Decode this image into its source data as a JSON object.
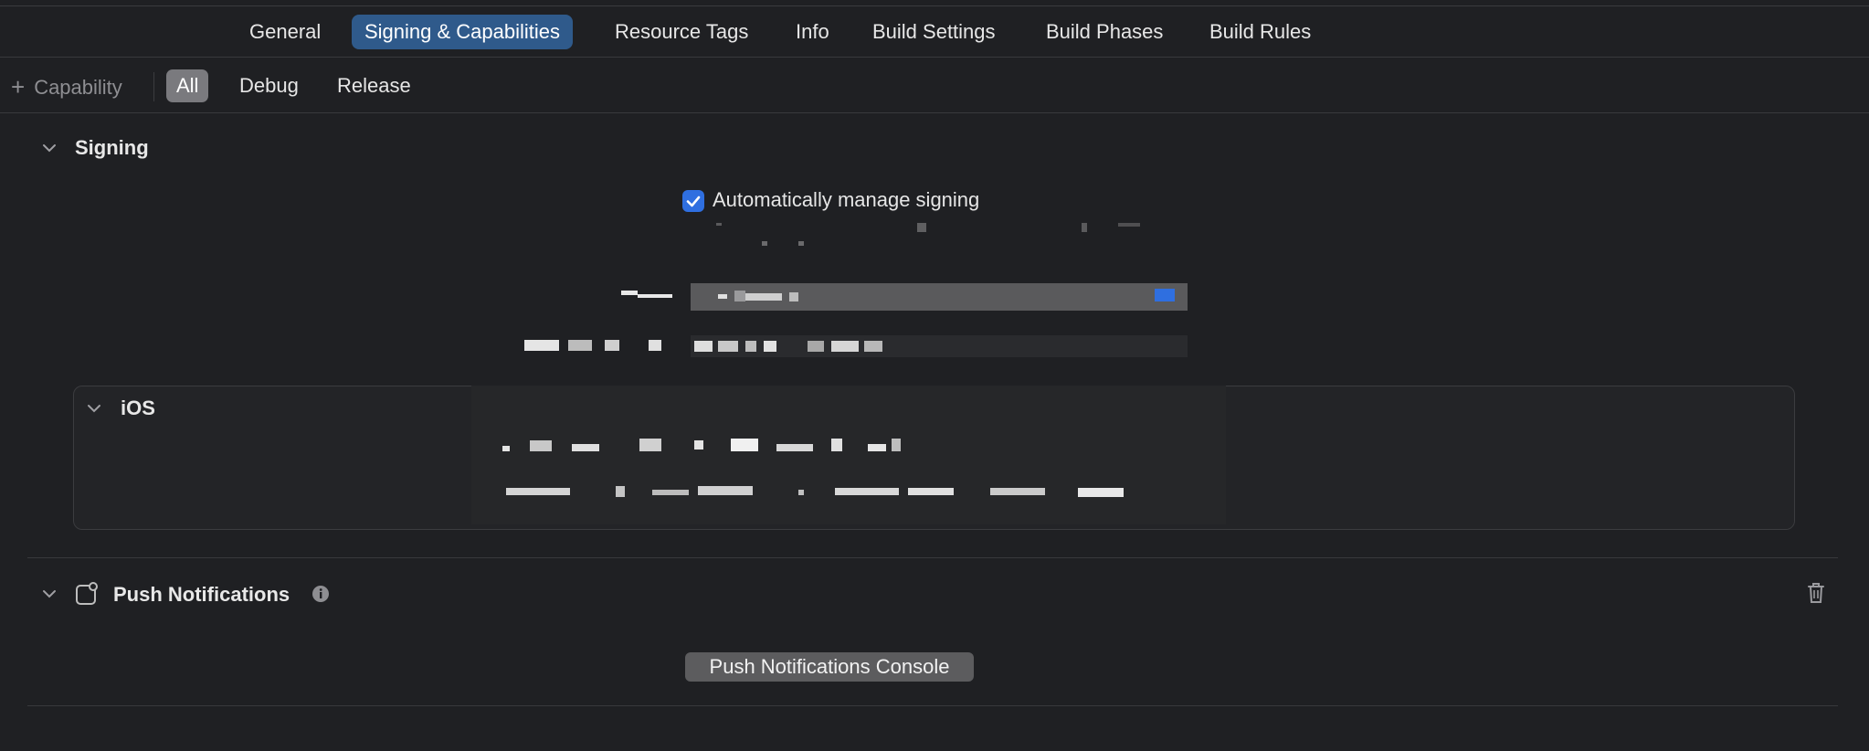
{
  "tabs": [
    {
      "label": "General",
      "active": false
    },
    {
      "label": "Signing & Capabilities",
      "active": true
    },
    {
      "label": "Resource Tags",
      "active": false
    },
    {
      "label": "Info",
      "active": false
    },
    {
      "label": "Build Settings",
      "active": false
    },
    {
      "label": "Build Phases",
      "active": false
    },
    {
      "label": "Build Rules",
      "active": false
    }
  ],
  "filterbar": {
    "capability_label": "Capability",
    "segments": [
      {
        "label": "All",
        "active": true
      },
      {
        "label": "Debug",
        "active": false
      },
      {
        "label": "Release",
        "active": false
      }
    ]
  },
  "signing": {
    "title": "Signing",
    "auto_manage_label": "Automatically manage signing",
    "auto_manage_checked": true
  },
  "ios": {
    "title": "iOS"
  },
  "push": {
    "title": "Push Notifications",
    "console_button": "Push Notifications Console"
  },
  "colors": {
    "background": "#1f2023",
    "accent": "#2f6fe0",
    "active_tab": "#2f5a8b"
  },
  "icons": {
    "add": "plus-icon",
    "collapse": "chevron-down-icon",
    "capability": "capability-icon",
    "info": "info-icon",
    "delete": "trash-icon"
  }
}
